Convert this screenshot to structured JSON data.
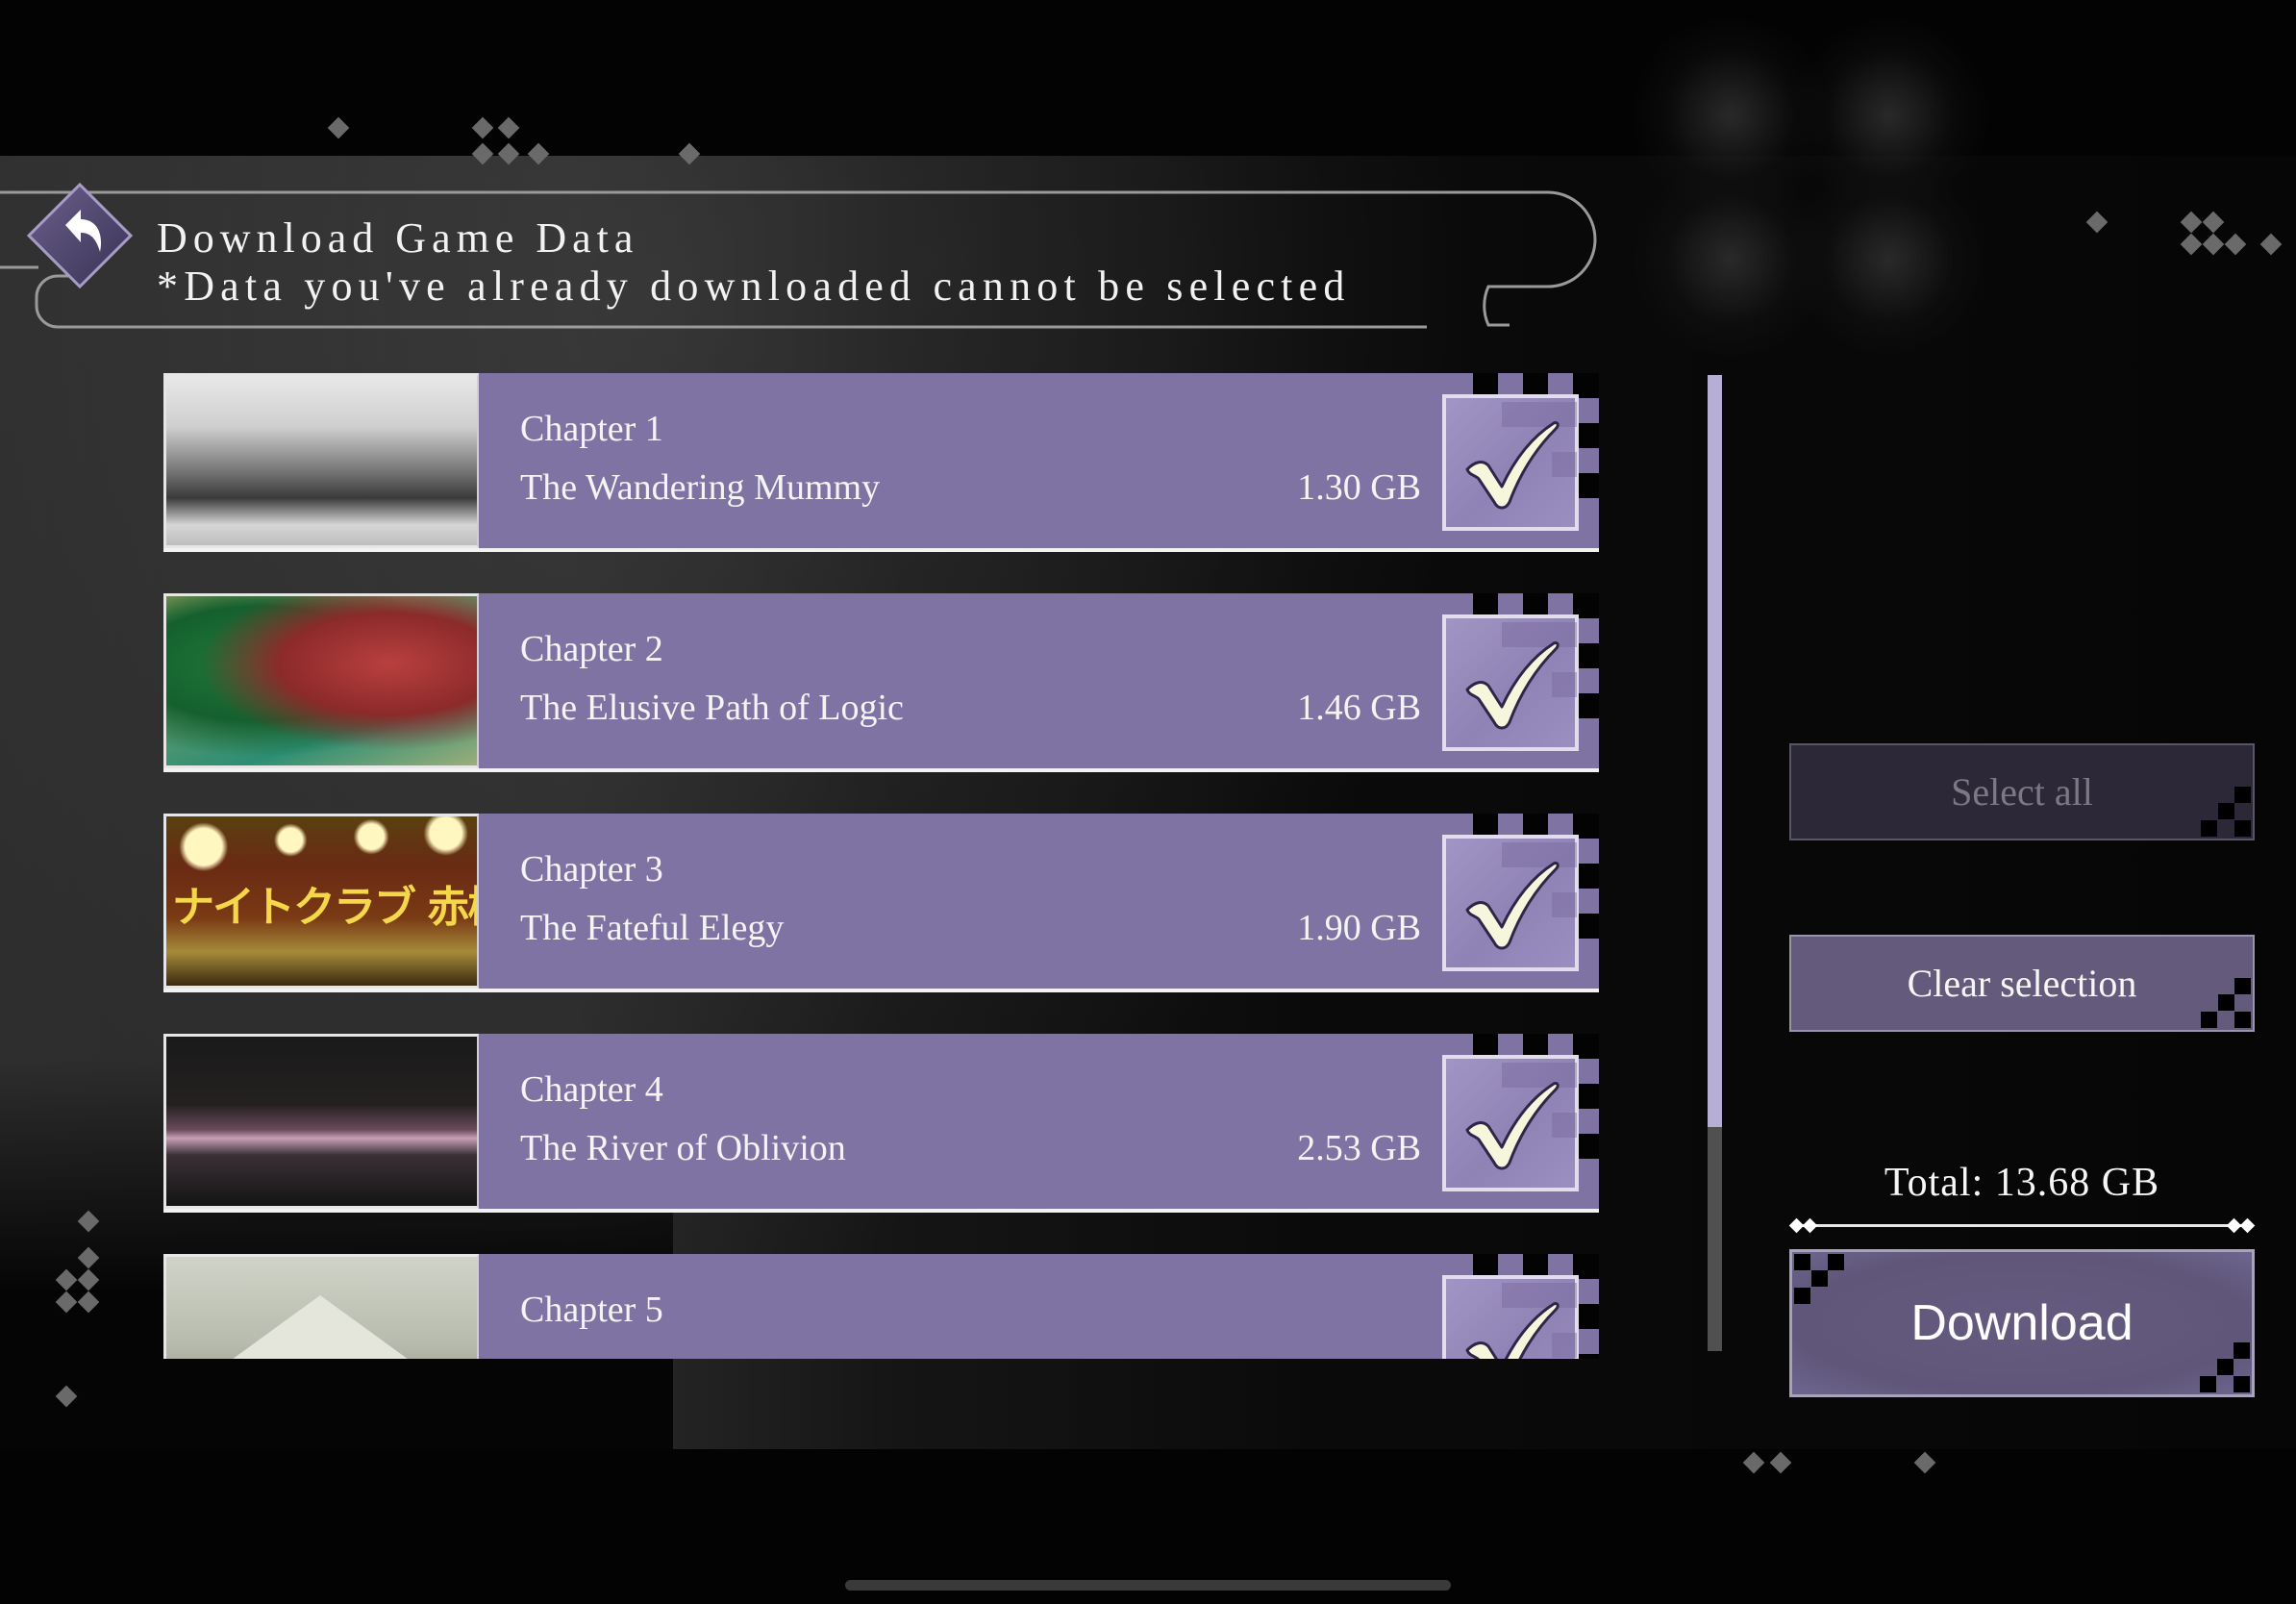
{
  "header": {
    "title": "Download Game Data",
    "subtitle": "*Data you've already downloaded cannot be selected",
    "back_icon": "back-arrow-icon"
  },
  "chapters": [
    {
      "chapter": "Chapter 1",
      "title": "The Wandering Mummy",
      "size": "1.30 GB",
      "checked": true,
      "thumbnail": "old-mansion-photo"
    },
    {
      "chapter": "Chapter 2",
      "title": "The Elusive Path of Logic",
      "size": "1.46 GB",
      "checked": true,
      "thumbnail": "red-camellia-flower"
    },
    {
      "chapter": "Chapter 3",
      "title": "The Fateful Elegy",
      "size": "1.90 GB",
      "checked": true,
      "thumbnail": "nightclub-sign",
      "thumbnail_text": "ナイトクラブ 赤椿"
    },
    {
      "chapter": "Chapter 4",
      "title": "The River of Oblivion",
      "size": "2.53 GB",
      "checked": true,
      "thumbnail": "dark-river"
    },
    {
      "chapter": "Chapter 5",
      "title": "",
      "size": "",
      "checked": true,
      "thumbnail": "misty-mountain"
    }
  ],
  "scroll": {
    "visible_fraction": 0.77,
    "position": 0.0
  },
  "sidebar": {
    "select_all_label": "Select all",
    "select_all_enabled": false,
    "clear_selection_label": "Clear selection",
    "total_label": "Total: 13.68 GB",
    "download_label": "Download"
  },
  "colors": {
    "row_purple": "#7f73a3",
    "scroll_thumb": "#b6aed4",
    "button_purple": "#635a7c",
    "disabled_button": "#2c2838"
  }
}
